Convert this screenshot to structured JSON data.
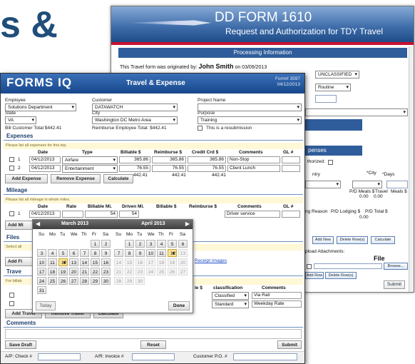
{
  "slide_title": "s &",
  "dd": {
    "title": "DD FORM 1610",
    "subtitle": "Request and Authorization for TDY Travel",
    "processing": "Processing Information",
    "originated_prefix": "This Travel form was originated by:",
    "originator": "John Smith",
    "originated_date": "on 03/09/2013",
    "classification": "UNCLASSIFIED",
    "priority": "Routine",
    "authorized_label": "thorized:",
    "expenses_label": "penses",
    "entry_label": "ntry",
    "city_label": "*City",
    "days_label": "*Days",
    "pd_meals_label": "P/D Meals $",
    "travel_label": "Travel",
    "meals_label": "Meals $",
    "meals_val": "0.00",
    "travel_val": "0.00",
    "reason_label": "ng Reason",
    "lodging_label": "P/D Lodging $",
    "total_label": "P/D Total $",
    "total_val": "0.00",
    "add_new": "Add New",
    "delete_rows": "Delete Row(s)",
    "calculate": "Calculate",
    "upload_label": "pload Attachments:",
    "file_header": "File",
    "browse": "Browse...",
    "add_row": "Add Row",
    "delete_rows2": "Delete Row(s)",
    "submit": "Submit"
  },
  "iq": {
    "logo": "FORMS IQ",
    "title": "Travel & Expense",
    "form_no": "Form# 3597",
    "form_date": "04/12/2013",
    "employee_label": "Employee",
    "employee_value": "Solutions Department",
    "customer_label": "Customer",
    "customer_value": "DATAWATCH",
    "project_label": "Project Name",
    "state_label": "State",
    "state_value": "VA",
    "city_label": "City",
    "city_value": "Washington DC Metro Area",
    "purpose_label": "Purpose",
    "purpose_value": "Training",
    "bill_total": "Bill Customer Total $442.41",
    "reimburse_total": "Reimburse Employee Total: $442.41",
    "resubmission": "This is a resubmission",
    "expenses": {
      "section": "Expenses",
      "note": "Please list all expenses for this trip.",
      "headers": [
        "Date",
        "Type",
        "Billable $",
        "Reimburse $",
        "Credit Crd $",
        "Comments",
        "GL #"
      ],
      "rows": [
        {
          "n": "1",
          "date": "04/12/2013",
          "type": "Airfare",
          "billable": "365.86",
          "reimburse": "365.86",
          "credit": "365.86",
          "comment": "Non-Stop"
        },
        {
          "n": "2",
          "date": "04/12/2013",
          "type": "Entertainment",
          "billable": "76.55",
          "reimburse": "76.55",
          "credit": "76.55",
          "comment": "Client Lunch"
        }
      ],
      "tot_billable": "442.41",
      "tot_reimburse": "442.41",
      "tot_credit": "442.41",
      "add": "Add Expense",
      "remove": "Remove Expense",
      "calc": "Calculate"
    },
    "mileage": {
      "section": "Mileage",
      "note": "Please list all mileage in whole miles.",
      "headers": [
        "Date",
        "Rate",
        "Billable Mi.",
        "Driven Mi.",
        "Billable $",
        "Reimburse $",
        "Comments",
        "GL #"
      ],
      "row": {
        "n": "1",
        "date": "04/12/2013",
        "billable_mi": "54",
        "driven_mi": "54",
        "comment": "Driver service"
      },
      "add_partial": "Add Mi"
    },
    "files": {
      "section": "Files",
      "note": "Select all",
      "add_partial": "Add Fi",
      "receipt_link": "Receipt Images"
    },
    "travel": {
      "section_partial": "Trave",
      "note_partial": "For billab",
      "col_partial": "le $",
      "col_class": "classification",
      "col_comments": "Comments",
      "rows": [
        {
          "class": "Classified",
          "comment": "Via Rail"
        },
        {
          "class": "Standard",
          "comment": "Weekday Rate"
        }
      ],
      "add": "Add Travel",
      "remove": "Remove Travel",
      "calc": "Calculate"
    },
    "comments": {
      "section": "Comments"
    },
    "save_draft": "Save Draft",
    "reset": "Reset",
    "submit": "Submit",
    "ap_check": "A/P: Check #",
    "ar_invoice": "A/R: Invoice #",
    "customer_po": "Customer P.O. #"
  },
  "calendar": {
    "month1": "March 2013",
    "month2": "April 2013",
    "dow": [
      "Su",
      "Mo",
      "Tu",
      "We",
      "Th",
      "Fr",
      "Sa"
    ],
    "march_weeks": [
      [
        "",
        "",
        "",
        "",
        "",
        "1",
        "2"
      ],
      [
        "3",
        "4",
        "5",
        "6",
        "7",
        "8",
        "9"
      ],
      [
        "10",
        "11",
        "12",
        "13",
        "14",
        "15",
        "16"
      ],
      [
        "17",
        "18",
        "19",
        "20",
        "21",
        "22",
        "23"
      ],
      [
        "24",
        "25",
        "26",
        "27",
        "28",
        "29",
        "30"
      ],
      [
        "31",
        "",
        "",
        "",
        "",
        "",
        ""
      ]
    ],
    "april_weeks": [
      [
        "",
        "1",
        "2",
        "3",
        "4",
        "5",
        "6"
      ],
      [
        "7",
        "8",
        "9",
        "10",
        "11",
        "12",
        "13"
      ],
      [
        "14",
        "15",
        "16",
        "17",
        "18",
        "19",
        "20"
      ],
      [
        "21",
        "22",
        "23",
        "24",
        "25",
        "26",
        "27"
      ],
      [
        "28",
        "29",
        "30",
        "",
        "",
        "",
        ""
      ]
    ],
    "selected": "12",
    "today_btn": "Today",
    "done_btn": "Done"
  },
  "colors": {
    "brand": "#17478c",
    "accent_red": "#c8102e",
    "selected_day": "#fbe497"
  }
}
